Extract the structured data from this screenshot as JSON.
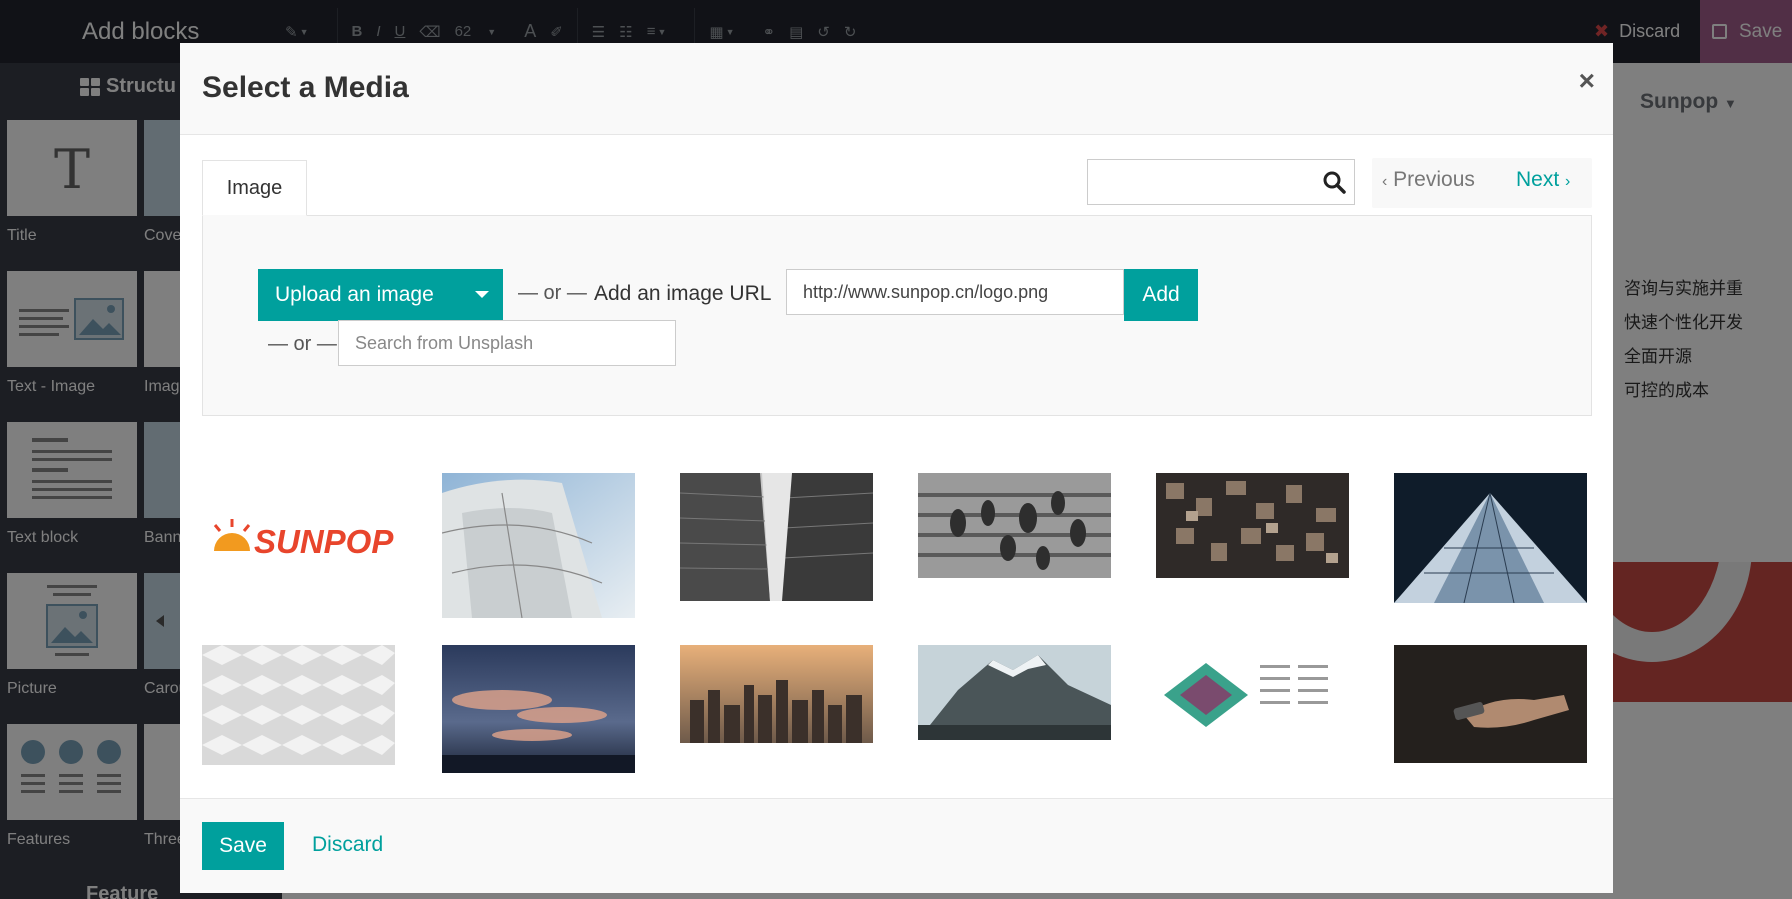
{
  "editor": {
    "sidebar_title": "Add blocks",
    "structure_label": "Structu",
    "feature_label": "Feature",
    "font_size": "62",
    "discard_label": "Discard",
    "save_label": "Save",
    "snippets": [
      {
        "label": "Title"
      },
      {
        "label": "Cove"
      },
      {
        "label": "Text - Image"
      },
      {
        "label": "Imag"
      },
      {
        "label": "Text block"
      },
      {
        "label": "Bann"
      },
      {
        "label": "Picture"
      },
      {
        "label": "Carou"
      },
      {
        "label": "Features"
      },
      {
        "label": "Three"
      }
    ]
  },
  "background_page": {
    "brand_menu": "Sunpop",
    "items": [
      "咨询与实施并重",
      "快速个性化开发",
      "全面开源",
      "可控的成本"
    ]
  },
  "modal": {
    "title": "Select a Media",
    "close_symbol": "×",
    "tab_label": "Image",
    "search_placeholder": "",
    "pager_prev": "Previous",
    "pager_next": "Next",
    "upload_label": "Upload an image",
    "or_text": "— or —",
    "url_label": "Add an image URL",
    "url_value": "http://www.sunpop.cn/logo.png",
    "add_label": "Add",
    "unsplash_placeholder": "Search from Unsplash",
    "images": [
      {
        "name": "sunpop-logo",
        "text": "SUNPOP"
      },
      {
        "name": "sail-sky"
      },
      {
        "name": "building-bw"
      },
      {
        "name": "crowd-stairs"
      },
      {
        "name": "type-blocks"
      },
      {
        "name": "glass-skyscraper"
      },
      {
        "name": "white-facade"
      },
      {
        "name": "sunset-clouds"
      },
      {
        "name": "city-skyline"
      },
      {
        "name": "mountain"
      },
      {
        "name": "diagram-graphic"
      },
      {
        "name": "hand-phone"
      }
    ],
    "save_label": "Save",
    "discard_label": "Discard"
  }
}
